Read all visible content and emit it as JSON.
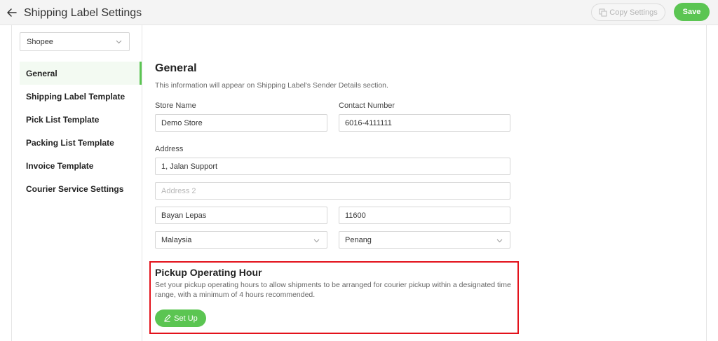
{
  "header": {
    "title": "Shipping Label Settings",
    "copy_label": "Copy Settings",
    "save_label": "Save"
  },
  "platform_select": {
    "value": "Shopee"
  },
  "sidebar": {
    "items": [
      {
        "label": "General",
        "active": true
      },
      {
        "label": "Shipping Label Template"
      },
      {
        "label": "Pick List Template"
      },
      {
        "label": "Packing List Template"
      },
      {
        "label": "Invoice Template"
      },
      {
        "label": "Courier Service Settings"
      }
    ]
  },
  "general": {
    "title": "General",
    "subtitle": "This information will appear on Shipping Label's Sender Details section.",
    "store_name_label": "Store Name",
    "store_name_value": "Demo Store",
    "contact_label": "Contact Number",
    "contact_value": "6016-4111111",
    "address_label": "Address",
    "address1_value": "1, Jalan Support",
    "address2_placeholder": "Address 2",
    "city_value": "Bayan Lepas",
    "postcode_value": "11600",
    "country_value": "Malaysia",
    "state_value": "Penang"
  },
  "pickup": {
    "title": "Pickup Operating Hour",
    "description": "Set your pickup operating hours to allow shipments to be arranged for courier pickup within a designated time range, with a minimum of 4 hours recommended.",
    "setup_label": "Set Up"
  },
  "icons": {
    "back": "arrow-left-icon",
    "copy": "copy-icon",
    "chevron": "chevron-down-icon",
    "edit": "pencil-icon"
  },
  "colors": {
    "accent": "#5bc552",
    "highlight": "#e3121b",
    "header_bg": "#f4f4f4"
  }
}
